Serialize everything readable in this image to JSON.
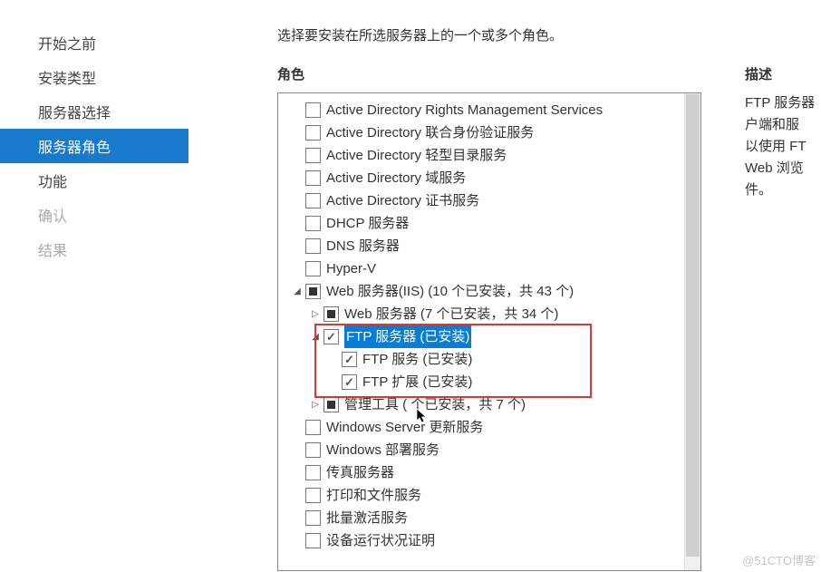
{
  "sidebar": {
    "items": [
      {
        "label": "开始之前",
        "state": "normal"
      },
      {
        "label": "安装类型",
        "state": "normal"
      },
      {
        "label": "服务器选择",
        "state": "normal"
      },
      {
        "label": "服务器角色",
        "state": "selected"
      },
      {
        "label": "功能",
        "state": "normal"
      },
      {
        "label": "确认",
        "state": "disabled"
      },
      {
        "label": "结果",
        "state": "disabled"
      }
    ]
  },
  "main": {
    "instruction": "选择要安装在所选服务器上的一个或多个角色。",
    "roles_header": "角色",
    "desc_header": "描述",
    "desc_lines": [
      "FTP 服务器",
      "户端和服",
      "以使用 FT",
      "Web 浏览",
      "件。"
    ],
    "roles": [
      {
        "indent": 0,
        "expander": "",
        "check": "unchecked",
        "label": "Active Directory Rights Management Services"
      },
      {
        "indent": 0,
        "expander": "",
        "check": "unchecked",
        "label": "Active Directory 联合身份验证服务"
      },
      {
        "indent": 0,
        "expander": "",
        "check": "unchecked",
        "label": "Active Directory 轻型目录服务"
      },
      {
        "indent": 0,
        "expander": "",
        "check": "unchecked",
        "label": "Active Directory 域服务"
      },
      {
        "indent": 0,
        "expander": "",
        "check": "unchecked",
        "label": "Active Directory 证书服务"
      },
      {
        "indent": 0,
        "expander": "",
        "check": "unchecked",
        "label": "DHCP 服务器"
      },
      {
        "indent": 0,
        "expander": "",
        "check": "unchecked",
        "label": "DNS 服务器"
      },
      {
        "indent": 0,
        "expander": "",
        "check": "unchecked",
        "label": "Hyper-V"
      },
      {
        "indent": 0,
        "expander": "expanded",
        "check": "partial",
        "label": "Web 服务器(IIS) (10 个已安装，共 43 个)"
      },
      {
        "indent": 1,
        "expander": "collapsed",
        "check": "partial",
        "label": "Web 服务器 (7 个已安装，共 34 个)"
      },
      {
        "indent": 1,
        "expander": "expanded",
        "check": "checked",
        "label": "FTP 服务器 (已安装)",
        "highlight": true
      },
      {
        "indent": 2,
        "expander": "",
        "check": "checked",
        "label": "FTP 服务 (已安装)"
      },
      {
        "indent": 2,
        "expander": "",
        "check": "checked",
        "label": "FTP 扩展 (已安装)"
      },
      {
        "indent": 1,
        "expander": "collapsed",
        "check": "partial",
        "label": "管理工具 (   个已安装，共 7 个)"
      },
      {
        "indent": 0,
        "expander": "",
        "check": "unchecked",
        "label": "Windows Server 更新服务"
      },
      {
        "indent": 0,
        "expander": "",
        "check": "unchecked",
        "label": "Windows 部署服务"
      },
      {
        "indent": 0,
        "expander": "",
        "check": "unchecked",
        "label": "传真服务器"
      },
      {
        "indent": 0,
        "expander": "",
        "check": "unchecked",
        "label": "打印和文件服务"
      },
      {
        "indent": 0,
        "expander": "",
        "check": "unchecked",
        "label": "批量激活服务"
      },
      {
        "indent": 0,
        "expander": "",
        "check": "unchecked",
        "label": "设备运行状况证明"
      }
    ]
  },
  "watermark": "@51CTO博客"
}
